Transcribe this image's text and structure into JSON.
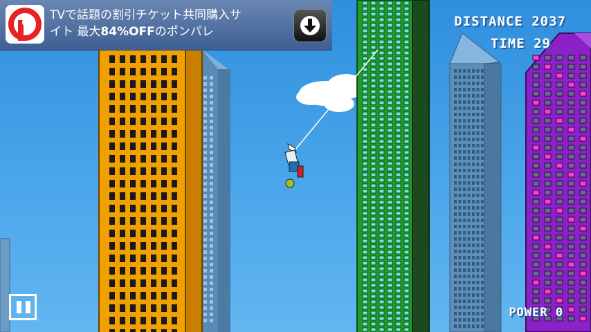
{
  "ad": {
    "line1": "TVで話題の割引チケット共同購入サ",
    "line2_prefix": "イト 最大",
    "line2_bold": "84%OFF",
    "line2_suffix": "のポンパレ",
    "logo_icon": "ponpare-logo-icon",
    "download_icon": "download-arrow-icon"
  },
  "hud": {
    "distance_label": "DISTANCE",
    "distance_value": "2037",
    "time_label": "TIME",
    "time_value": "29",
    "power_label": "POWER",
    "power_value": "0"
  },
  "controls": {
    "pause_icon": "pause-icon"
  },
  "colors": {
    "sky": "#3a98e2",
    "orange_building": "#f0a000",
    "green_building": "#1f9a2c",
    "purple_building": "#8a22c8",
    "blue_tower": "#5f8fb8"
  }
}
